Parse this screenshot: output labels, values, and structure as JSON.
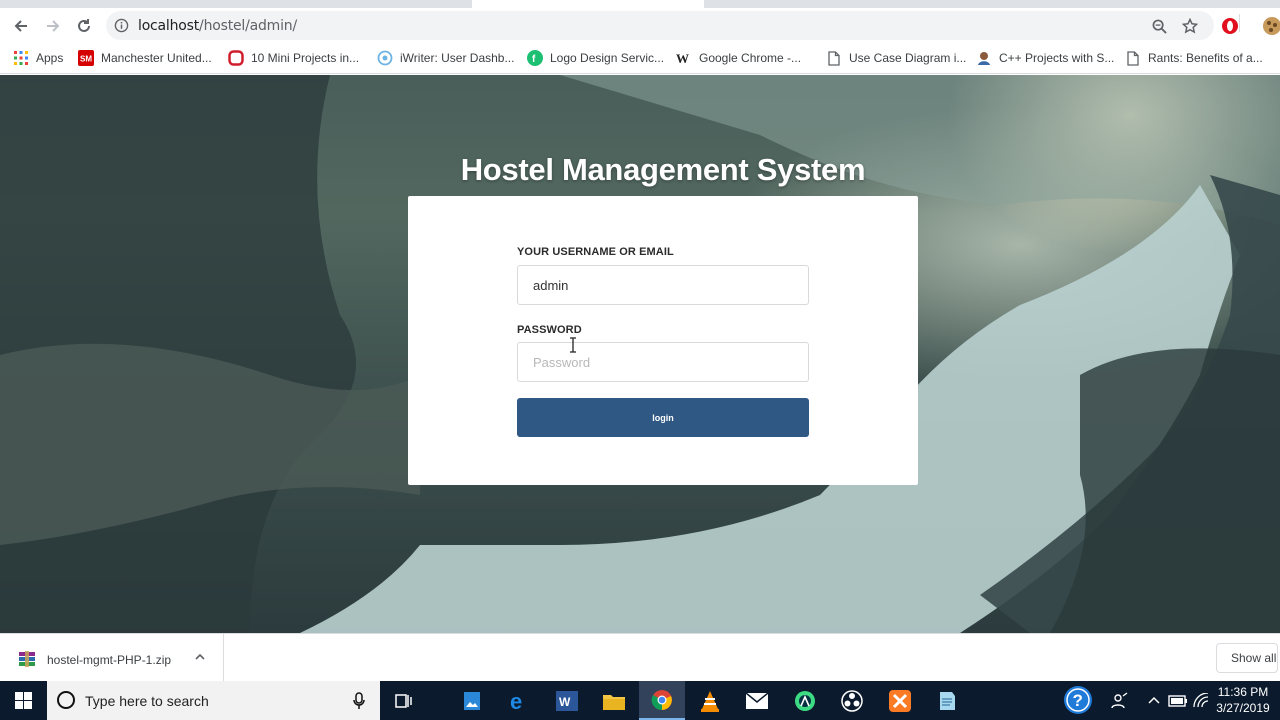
{
  "browser": {
    "url_host": "localhost",
    "url_path": "/hostel/admin/",
    "bookmarks": [
      {
        "label": "Apps",
        "icon": "apps-grid-icon"
      },
      {
        "label": "Manchester United...",
        "icon": "manchester-united-icon"
      },
      {
        "label": "10 Mini Projects in...",
        "icon": "red-o-icon"
      },
      {
        "label": "iWriter: User Dashb...",
        "icon": "iwriter-icon"
      },
      {
        "label": "Logo Design Servic...",
        "icon": "fiverr-icon"
      },
      {
        "label": "Google Chrome -...",
        "icon": "wikipedia-icon"
      },
      {
        "label": "Use Case Diagram i...",
        "icon": "page-icon"
      },
      {
        "label": "C++ Projects with S...",
        "icon": "cpp-icon"
      },
      {
        "label": "Rants: Benefits of a...",
        "icon": "page-icon"
      }
    ]
  },
  "page": {
    "title": "Hostel Management System",
    "username_label": "YOUR USERNAME OR EMAIL",
    "username_value": "admin",
    "password_label": "PASSWORD",
    "password_placeholder": "Password",
    "login_label": "login"
  },
  "downloads": {
    "file_name": "hostel-mgmt-PHP-1.zip",
    "show_all_label": "Show all"
  },
  "taskbar": {
    "search_placeholder": "Type here to search",
    "time": "11:36 PM",
    "date": "3/27/2019",
    "apps": [
      "task-view-icon",
      "photos-icon",
      "edge-icon",
      "word-icon",
      "file-explorer-icon",
      "chrome-icon",
      "vlc-icon",
      "mail-icon",
      "android-studio-icon",
      "obs-icon",
      "xampp-icon",
      "notepad-icon"
    ]
  },
  "colors": {
    "login_button": "#2f5884",
    "taskbar": "#0b1a2c"
  }
}
